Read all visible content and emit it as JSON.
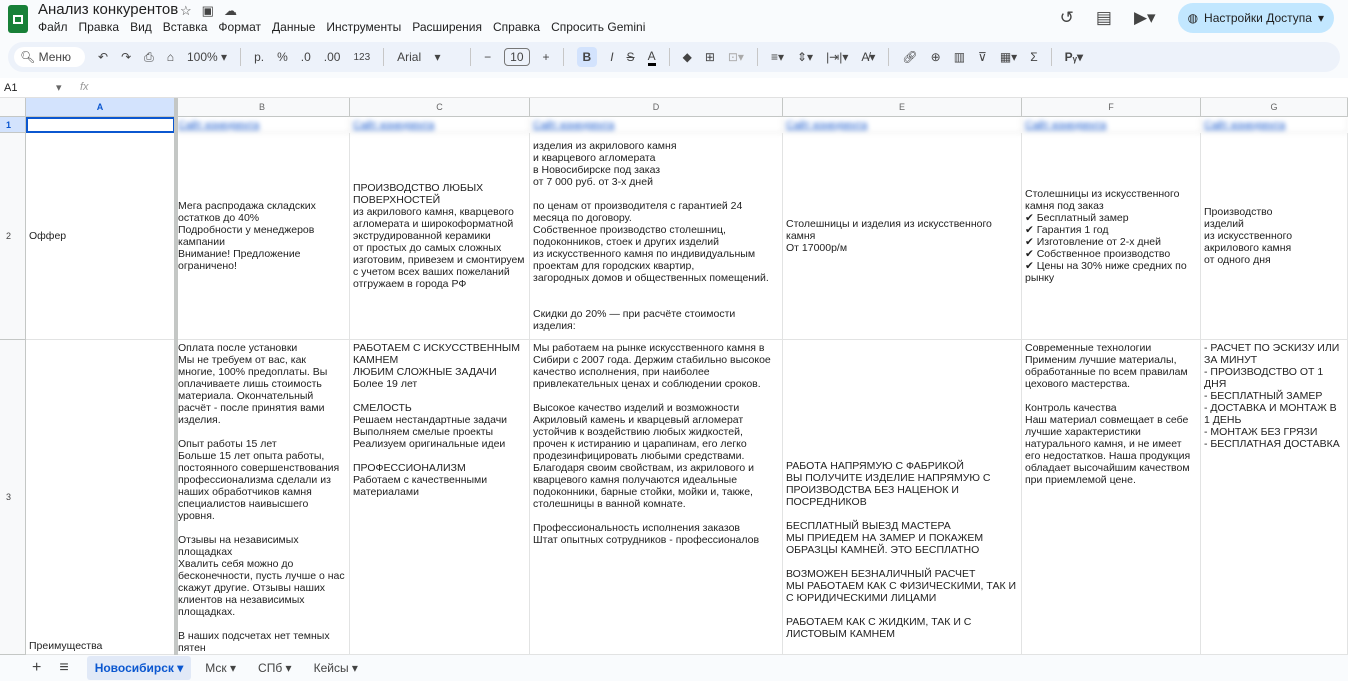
{
  "doc": {
    "title": "Анализ конкурентов",
    "menu": [
      "Файл",
      "Правка",
      "Вид",
      "Вставка",
      "Формат",
      "Данные",
      "Инструменты",
      "Расширения",
      "Справка",
      "Спросить Gemini"
    ],
    "share_label": "Настройки Доступа"
  },
  "toolbar": {
    "search": "Меню",
    "zoom": "100%",
    "currency": "р.",
    "percent": "%",
    "dec_less": ".0",
    "dec_more": ".00",
    "format": "123",
    "font": "Arial",
    "font_size": "10",
    "bold": "B",
    "italic": "I",
    "strike": "S",
    "textcolor": "A"
  },
  "formula": {
    "cell": "A1",
    "fx": "fx"
  },
  "columns": [
    "A",
    "B",
    "C",
    "D",
    "E",
    "F",
    "G"
  ],
  "rows": [
    {
      "num": "1",
      "cells": [
        "",
        "Сайт конкурента",
        "Сайт конкурента",
        "Сайт конкурента",
        "Сайт конкурента",
        "Сайт конкурента",
        "Сайт конкурента"
      ]
    },
    {
      "num": "2",
      "cells": [
        "Оффер",
        "Мега распродажа складских остатков до 40%\nПодробности у менеджеров кампании\nВнимание! Предложение ограничено!",
        "ПРОИЗВОДСТВО ЛЮБЫХ ПОВЕРХНОСТЕЙ\nиз акрилового камня, кварцевого агломерата и широкоформатной экструдированной керамики\nот простых до самых сложных изготовим, привезем и смонтируем с учетом всех ваших пожеланий\nотгружаем в города РФ",
        "изделия из акрилового камня\nи кварцевого агломерата\nв Новосибирске под заказ\nот 7 000 руб. от 3-х дней\n\nпо ценам от производителя с гарантией 24 месяца по договору.\nСобственное производство столешниц, подоконников, стоек и других изделий\nиз искусственного камня по индивидуальным проектам для городских квартир,\nзагородных домов и общественных помещений.\n\n\nСкидки до 20% — при расчёте стоимости изделия:\n",
        "Столешницы и изделия из искусственного камня\nОт 17000р/м",
        "Столешницы из искусственного камня под заказ\n✔ Бесплатный замер\n✔ Гарантия 1 год\n✔ Изготовление от 2-х дней\n✔ Собственное производство\n✔ Цены на 30% ниже средних по рынку",
        "Производство\nизделий\nиз искусственного\nакрилового камня\nот одного дня"
      ]
    },
    {
      "num": "3",
      "cells": [
        "Преимущества",
        "Оплата после установки\nМы не требуем от вас, как многие, 100% предоплаты. Вы оплачиваете лишь стоимость материала. Окончательный расчёт - после принятия вами изделия.\n\nОпыт работы 15 лет\nБольше 15 лет опыта работы, постоянного совершенствования профессионализма сделали из наших обработчиков камня специалистов наивысшего уровня.\n\nОтзывы на независимых площадках\nХвалить себя можно до бесконечности, пусть лучше о нас скажут другие. Отзывы наших клиентов на независимых площадках.\n\nВ наших подсчетах нет темных пятен\nПолная прозрачность подсчётов и",
        "РАБОТАЕМ С ИСКУССТВЕННЫМ КАМНЕМ\nЛЮБИМ СЛОЖНЫЕ ЗАДАЧИ\nБолее 19 лет\n\nСМЕЛОСТЬ\nРешаем нестандартные задачи\nВыполняем смелые проекты\nРеализуем оригинальные идеи\n\nПРОФЕССИОНАЛИЗМ\nРаботаем с качественными материалами",
        "Мы работаем на рынке искусственного камня в Сибири с 2007 года. Держим стабильно высокое качество исполнения, при наиболее привлекательных ценах и соблюдении сроков.\n\nВысокое качество изделий и возможности\nАкриловый камень и кварцевый агломерат устойчив к воздействию любых жидкостей, прочен к истиранию и царапинам, его легко продезинфицировать любыми средствами.\nБлагодаря своим свойствам, из акрилового и кварцевого камня получаются идеальные подоконники, барные стойки, мойки и, также, столешницы в ванной комнате.\n\nПрофессиональность исполнения заказов\nШтат опытных сотрудников - профессионалов",
        "РАБОТА НАПРЯМУЮ С ФАБРИКОЙ\nВЫ ПОЛУЧИТЕ ИЗДЕЛИЕ НАПРЯМУЮ С ПРОИЗВОДСТВА БЕЗ НАЦЕНОК И ПОСРЕДНИКОВ\n\nБЕСПЛАТНЫЙ ВЫЕЗД МАСТЕРА\nМЫ ПРИЕДЕМ НА ЗАМЕР И ПОКАЖЕМ ОБРАЗЦЫ КАМНЕЙ. ЭТО БЕСПЛАТНО\n\nВОЗМОЖЕН БЕЗНАЛИЧНЫЙ РАСЧЕТ\nМЫ РАБОТАЕМ КАК С ФИЗИЧЕСКИМИ, ТАК И С ЮРИДИЧЕСКИМИ ЛИЦАМИ\n\nРАБОТАЕМ КАК С ЖИДКИМ, ТАК И С ЛИСТОВЫМ КАМНЕМ",
        "Современные технологии\nПрименим лучшие материалы, обработанные по всем правилам цехового мастерства.\n\nКонтроль качества\nНаш материал совмещает в себе лучшие характеристики натурального камня, и не имеет его недостатков. Наша продукция обладает высочайшим качеством при приемлемой цене.",
        "- РАСЧЕТ ПО ЭСКИЗУ ИЛИ ЗА МИНУТ\n- ПРОИЗВОДСТВО ОТ 1 ДНЯ\n- БЕСПЛАТНЫЙ ЗАМЕР\n- ДОСТАВКА И МОНТАЖ В 1 ДЕНЬ\n- МОНТАЖ БЕЗ ГРЯЗИ\n- БЕСПЛАТНАЯ ДОСТАВКА"
      ]
    }
  ],
  "sheets": [
    "Новосибирск",
    "Мск",
    "СПб",
    "Кейсы"
  ]
}
